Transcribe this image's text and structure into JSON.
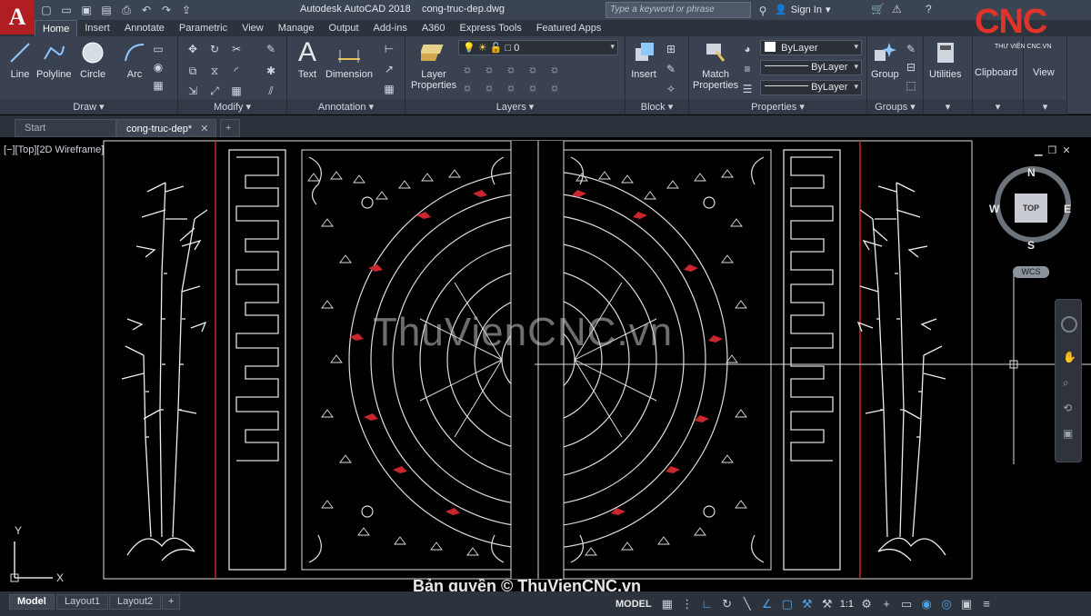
{
  "app": {
    "logo_letter": "A",
    "title": "Autodesk AutoCAD 2018",
    "document": "cong-truc-dep.dwg",
    "search_placeholder": "Type a keyword or phrase",
    "sign_in": "Sign In",
    "cnc_logo": "CNC",
    "cnc_sub": "THƯ VIỆN CNC.VN"
  },
  "ribbon_tabs": [
    "Home",
    "Insert",
    "Annotate",
    "Parametric",
    "View",
    "Manage",
    "Output",
    "Add-ins",
    "A360",
    "Express Tools",
    "Featured Apps"
  ],
  "ribbon": {
    "draw": {
      "title": "Draw",
      "line": "Line",
      "polyline": "Polyline",
      "circle": "Circle",
      "arc": "Arc"
    },
    "modify": {
      "title": "Modify"
    },
    "annotation": {
      "title": "Annotation",
      "text": "Text",
      "dimension": "Dimension"
    },
    "layers": {
      "title": "Layers",
      "layer_properties_1": "Layer",
      "layer_properties_2": "Properties",
      "current_layer": "0"
    },
    "block": {
      "title": "Block",
      "insert": "Insert"
    },
    "properties": {
      "title": "Properties",
      "match_1": "Match",
      "match_2": "Properties",
      "color": "ByLayer",
      "linetype": "ByLayer",
      "lineweight": "ByLayer"
    },
    "groups": {
      "title": "Groups",
      "group": "Group"
    },
    "utilities": {
      "title": "Utilities"
    },
    "clipboard": {
      "title": "Clipboard"
    },
    "view": {
      "title": "View"
    }
  },
  "doc_tabs": {
    "start": "Start",
    "active": "cong-truc-dep*",
    "add": "+"
  },
  "viewport": {
    "label": "[−][Top][2D Wireframe]"
  },
  "viewcube": {
    "top": "TOP",
    "n": "N",
    "s": "S",
    "e": "E",
    "w": "W",
    "wcs": "WCS"
  },
  "ucs": {
    "x": "X",
    "y": "Y"
  },
  "watermark": "ThuVienCNC.vn",
  "copyright": "Bản quyền © ThuVienCNC.vn",
  "layout_tabs": [
    "Model",
    "Layout1",
    "Layout2",
    "+"
  ],
  "status": {
    "model": "MODEL",
    "scale": "1:1"
  },
  "colors": {
    "accent": "#b01e23",
    "ribbon": "#3a4150",
    "red_line": "#c8282d",
    "highlight": "#4ea3e8"
  }
}
